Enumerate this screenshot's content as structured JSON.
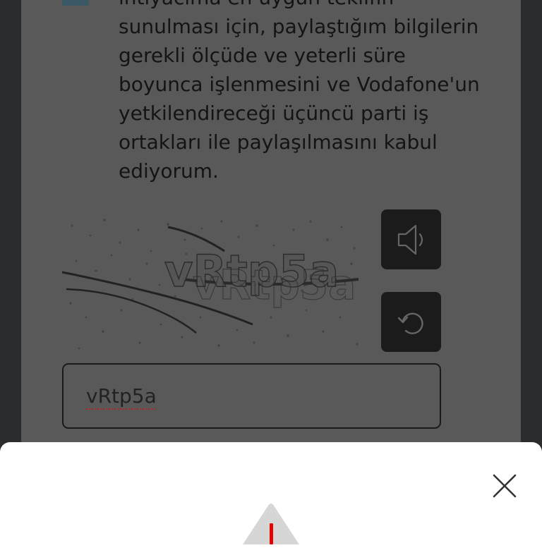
{
  "consent": {
    "lines": [
      "ihtiyacıma en uygun teklifin",
      "sunulması için, paylaştığım bilgilerin",
      "gerekli ölçüde ve yeterli süre",
      "boyunca işlenmesini ve Vodafone'un",
      "yetkilendireceği üçüncü parti iş",
      "ortakları ile paylaşılmasını kabul",
      "ediyorum."
    ]
  },
  "captcha": {
    "image_text": "vRtp5a",
    "audio_icon": "speaker-icon",
    "refresh_icon": "refresh-icon",
    "input_value": "vRtp5a"
  },
  "sheet": {
    "close_icon": "close-icon",
    "warning_icon": "warning-icon"
  },
  "colors": {
    "overlay": "#595959",
    "accent": "#e60000",
    "sheet": "#ffffff"
  }
}
